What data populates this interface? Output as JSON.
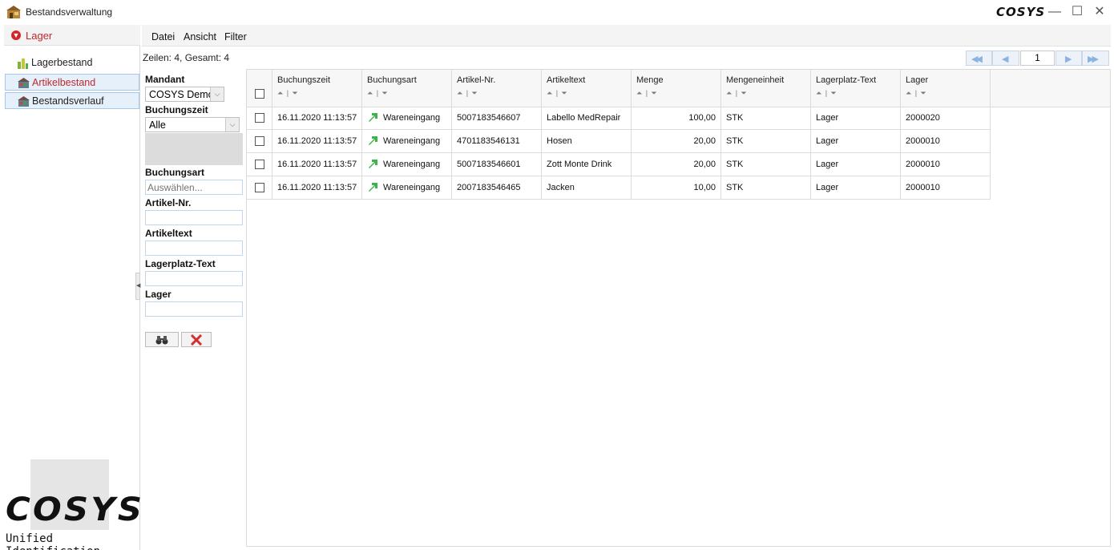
{
  "window": {
    "title": "Bestandsverwaltung",
    "brand": "COSYS",
    "controls": {
      "minimize": "—",
      "maximize": "☐",
      "close": "✕"
    }
  },
  "sidebar": {
    "header": "Lager",
    "items": [
      {
        "label": "Lagerbestand",
        "icon": "bar-chart-icon",
        "active": false
      },
      {
        "label": "Artikelbestand",
        "icon": "warehouse-icon",
        "active": true
      },
      {
        "label": "Bestandsverlauf",
        "icon": "warehouse-icon",
        "active": false
      }
    ],
    "logo": {
      "wordmark": "COSYS",
      "tagline": "Unified Identification"
    }
  },
  "menu": {
    "items": [
      "Datei",
      "Ansicht",
      "Filter"
    ]
  },
  "rows_info": "Zeilen: 4, Gesamt: 4",
  "pager": {
    "page": "1",
    "first": "◀◀",
    "prev": "◀",
    "next": "▶",
    "last": "▶▶"
  },
  "filters": {
    "mandant": {
      "label": "Mandant",
      "value": "COSYS Demo"
    },
    "buchungszeit": {
      "label": "Buchungszeit",
      "value": "Alle"
    },
    "buchungsart": {
      "label": "Buchungsart",
      "placeholder": "Auswählen..."
    },
    "artikel_nr": {
      "label": "Artikel-Nr."
    },
    "artikeltext": {
      "label": "Artikeltext"
    },
    "lagerplatz_text": {
      "label": "Lagerplatz-Text"
    },
    "lager": {
      "label": "Lager"
    },
    "buttons": {
      "search": "binoculars-icon",
      "clear": "red-x-icon"
    }
  },
  "grid": {
    "columns": [
      "Buchungszeit",
      "Buchungsart",
      "Artikel-Nr.",
      "Artikeltext",
      "Menge",
      "Mengeneinheit",
      "Lagerplatz-Text",
      "Lager"
    ],
    "sort_glyphs": "⏶ | ⏷",
    "rows": [
      {
        "buchungszeit": "16.11.2020 11:13:57",
        "buchungsart": "Wareneingang",
        "artikel_nr": "5007183546607",
        "artikeltext": "Labello MedRepair",
        "menge": "100,00",
        "einheit": "STK",
        "lagerplatz": "Lager",
        "lager": "2000020"
      },
      {
        "buchungszeit": "16.11.2020 11:13:57",
        "buchungsart": "Wareneingang",
        "artikel_nr": "4701183546131",
        "artikeltext": "Hosen",
        "menge": "20,00",
        "einheit": "STK",
        "lagerplatz": "Lager",
        "lager": "2000010"
      },
      {
        "buchungszeit": "16.11.2020 11:13:57",
        "buchungsart": "Wareneingang",
        "artikel_nr": "5007183546601",
        "artikeltext": "Zott Monte Drink",
        "menge": "20,00",
        "einheit": "STK",
        "lagerplatz": "Lager",
        "lager": "2000010"
      },
      {
        "buchungszeit": "16.11.2020 11:13:57",
        "buchungsart": "Wareneingang",
        "artikel_nr": "2007183546465",
        "artikeltext": "Jacken",
        "menge": "10,00",
        "einheit": "STK",
        "lagerplatz": "Lager",
        "lager": "2000010"
      }
    ]
  },
  "colors": {
    "accent_red": "#c0282e",
    "selection_bg": "#e6f0fb",
    "arrow_green": "#3cb44a",
    "pager_blue": "#8cb3e0"
  }
}
